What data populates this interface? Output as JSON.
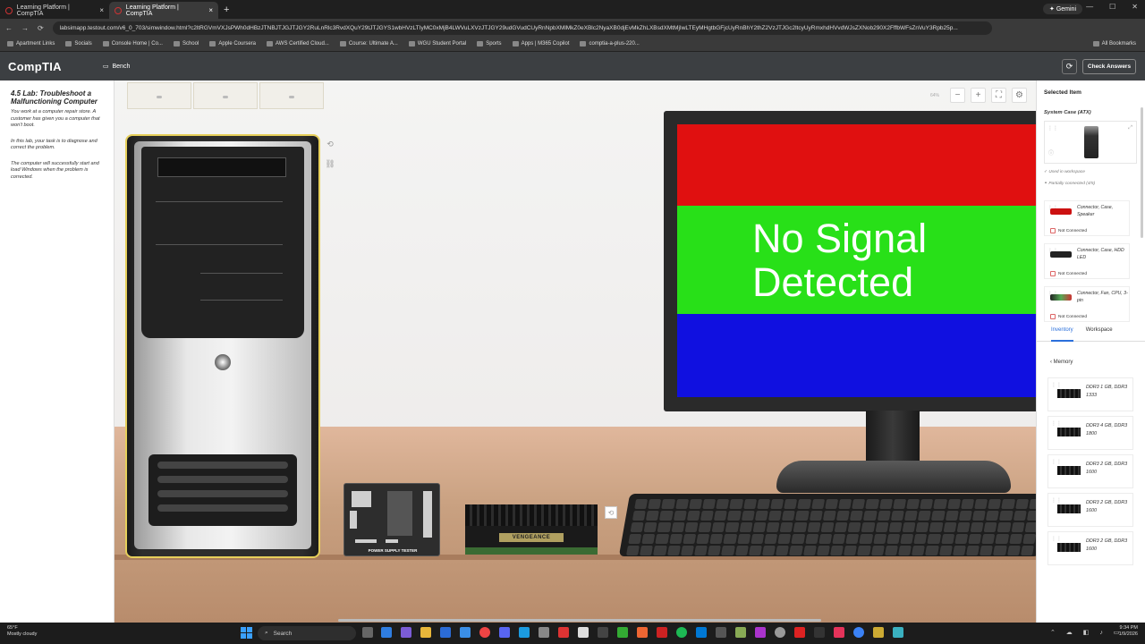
{
  "browser": {
    "tabs": [
      {
        "label": "Learning Platform | CompTIA",
        "close": "×"
      },
      {
        "label": "Learning Platform | CompTIA",
        "close": "×"
      }
    ],
    "new_tab": "+",
    "gemini": "✦ Gemini",
    "window_controls": [
      "—",
      "☐",
      "✕"
    ],
    "nav": [
      "←",
      "→",
      "⟳"
    ],
    "url": "labsimapp.testout.com/v6_0_703/simwindow.html?c2ltRGVmVXJsPWh0dHBzJTNBJTJGJTJGY2RuLnRlc3RvdXQuY29tJTJGYS1wbHVzLTIyMC0xMjB4LWVuLXVzJTJGY29udGVudCUyRnNpbXMlMkZ0eXBlc2NyaXB0djEvMkZhLXBsdXMtMjIwLTEyMHgtbGFjcUyRnBhY2thZ2VzJTJGc2ltcyUyRmxhdHVvdWJsZXNob290X2FffbWFsZnVuY3Rpb25p...",
    "bookmarks": [
      "Apartment Links",
      "Socials",
      "Console Home | Co...",
      "School",
      "Apple Coursera",
      "AWS Certified Cloud...",
      "Course: Ultimate A...",
      "WGU Student Portal",
      "Sports",
      "Apps | M365 Copilot",
      "comptia-a-plus-220..."
    ],
    "all_bookmarks": "All Bookmarks"
  },
  "app": {
    "logo": "CompTIA",
    "bench_label": "Bench",
    "check_answers": "Check Answers",
    "refresh_icon": "⟳"
  },
  "instructions": {
    "title": "4.5 Lab: Troubleshoot a Malfunctioning Computer",
    "paragraphs": [
      "You work at a computer repair store. A customer has given you a computer that won't boot.",
      "In this lab, your task is to diagnose and correct the problem.",
      "The computer will successfully start and load Windows when the problem is corrected."
    ]
  },
  "stage": {
    "zoom_pct": "64%",
    "monitor_text": [
      "No Signal",
      "Detected"
    ],
    "psu_tester_label": "POWER SUPPLY TESTER",
    "ram_brand": "VENGEANCE"
  },
  "right_panel": {
    "title": "Selected Item",
    "selected_name": "System Case (ATX)",
    "used_in_workspace": "Used in workspace",
    "partially_connected": "Partially connected (4/5)",
    "connectors": [
      {
        "label": "Connector, Case, Speaker",
        "status": "Not Connected"
      },
      {
        "label": "Connector, Case, HDD LED",
        "status": "Not Connected"
      },
      {
        "label": "Connector, Fan, CPU, 3-pin",
        "status": "Not Connected"
      }
    ],
    "tabs": {
      "inventory": "Inventory",
      "workspace": "Workspace"
    },
    "category": "Memory",
    "inventory": [
      {
        "label": "DDR3 1 GB, DDR3 1333"
      },
      {
        "label": "DDR3 4 GB, DDR3 1800"
      },
      {
        "label": "DDR3 2 GB, DDR3 1600"
      },
      {
        "label": "DDR3 2 GB, DDR3 1600"
      },
      {
        "label": "DDR3 2 GB, DDR3 1600"
      }
    ]
  },
  "taskbar": {
    "weather_temp": "65°F",
    "weather_desc": "Mostly cloudy",
    "search": "Search",
    "time": "9:34 PM",
    "date": "1/9/2026"
  }
}
